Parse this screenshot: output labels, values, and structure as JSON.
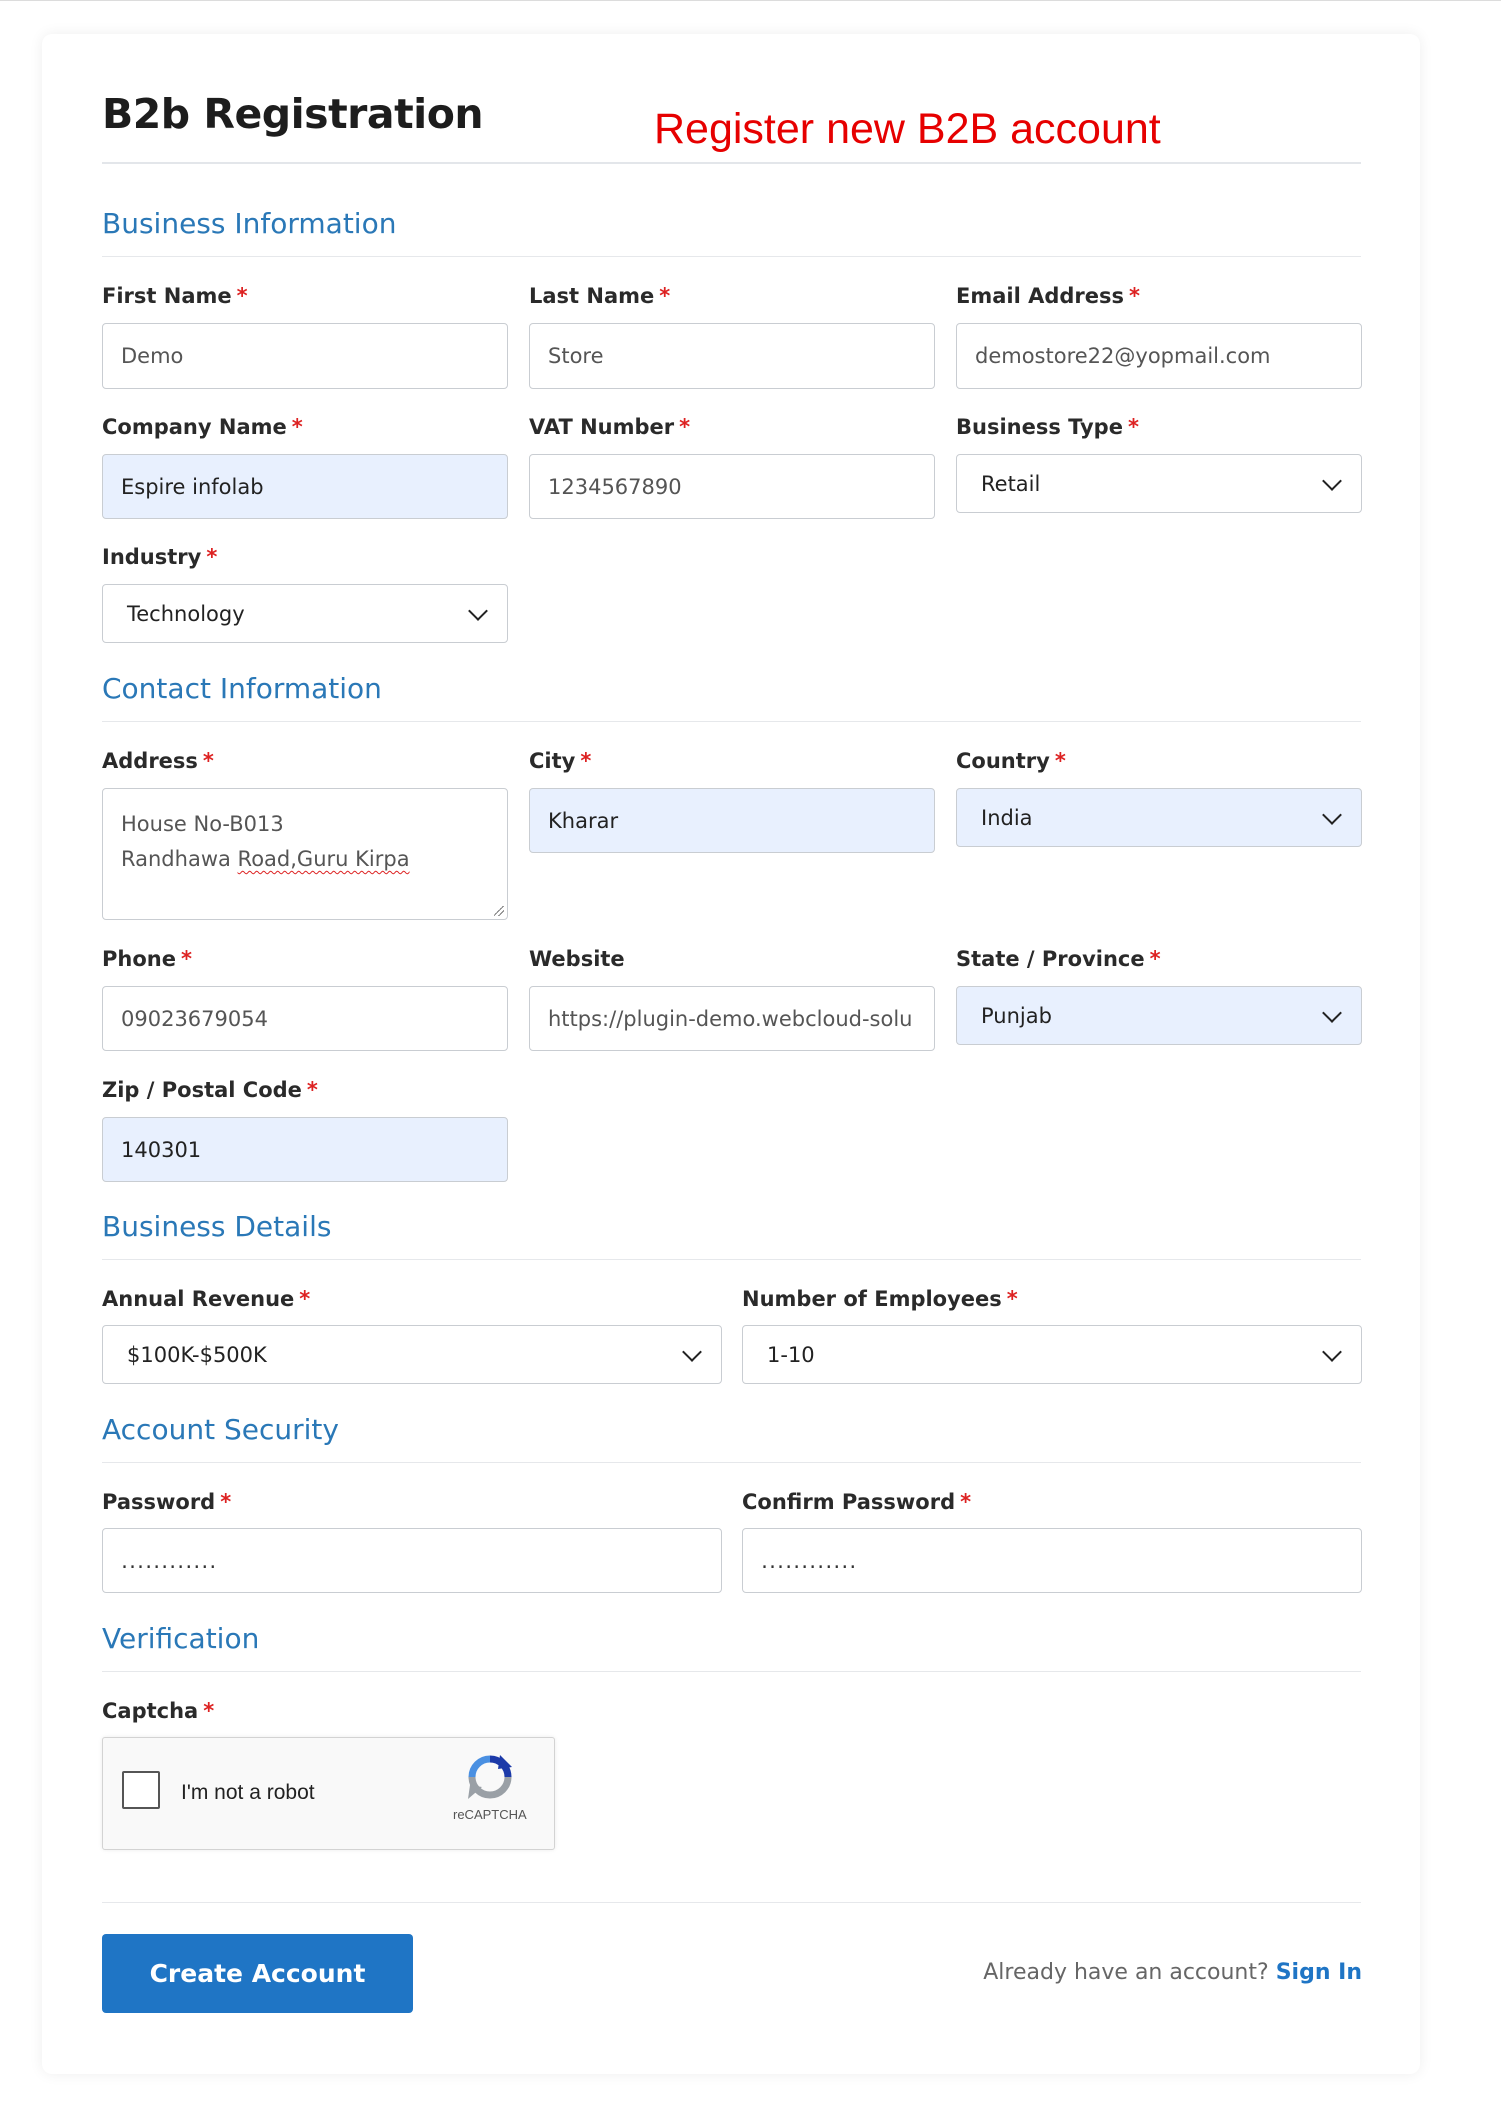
{
  "header": {
    "title": "B2b Registration",
    "annotation": "Register new B2B account"
  },
  "sections": {
    "business_information": "Business Information",
    "contact_information": "Contact Information",
    "business_details": "Business Details",
    "account_security": "Account Security",
    "verification": "Verification"
  },
  "required_marker": "*",
  "fields": {
    "first_name": {
      "label": "First Name",
      "value": "Demo"
    },
    "last_name": {
      "label": "Last Name",
      "value": "Store"
    },
    "email": {
      "label": "Email Address",
      "value": "demostore22@yopmail.com"
    },
    "company_name": {
      "label": "Company Name",
      "value": "Espire infolab"
    },
    "vat_number": {
      "label": "VAT Number",
      "value": "1234567890"
    },
    "business_type": {
      "label": "Business Type",
      "value": "Retail"
    },
    "industry": {
      "label": "Industry",
      "value": "Technology"
    },
    "address": {
      "label": "Address",
      "line1": "House No-B013",
      "line2_plain": "Randhawa ",
      "line2_marked": "Road,Guru Kirpa"
    },
    "city": {
      "label": "City",
      "value": "Kharar"
    },
    "country": {
      "label": "Country",
      "value": "India"
    },
    "phone": {
      "label": "Phone",
      "value": "09023679054"
    },
    "website": {
      "label": "Website",
      "value": "https://plugin-demo.webcloud-solu"
    },
    "state": {
      "label": "State / Province",
      "value": "Punjab"
    },
    "zip": {
      "label": "Zip / Postal Code",
      "value": "140301"
    },
    "annual_revenue": {
      "label": "Annual Revenue",
      "value": "$100K-$500K"
    },
    "employees": {
      "label": "Number of Employees",
      "value": "1-10"
    },
    "password": {
      "label": "Password",
      "value": "․․․․․․․․․․․․"
    },
    "confirm_password": {
      "label": "Confirm Password",
      "value": "․․․․․․․․․․․․"
    },
    "captcha": {
      "label": "Captcha",
      "checkbox_text": "I'm not a robot",
      "brand": "reCAPTCHA"
    }
  },
  "footer": {
    "submit_label": "Create Account",
    "already_text": "Already have an account?",
    "signin_label": "Sign In"
  },
  "colors": {
    "accent": "#1f75c5",
    "section_heading": "#2a78b7",
    "required": "#dd2222",
    "annotation": "#e60000",
    "autofill_bg": "#e8f0fe"
  }
}
